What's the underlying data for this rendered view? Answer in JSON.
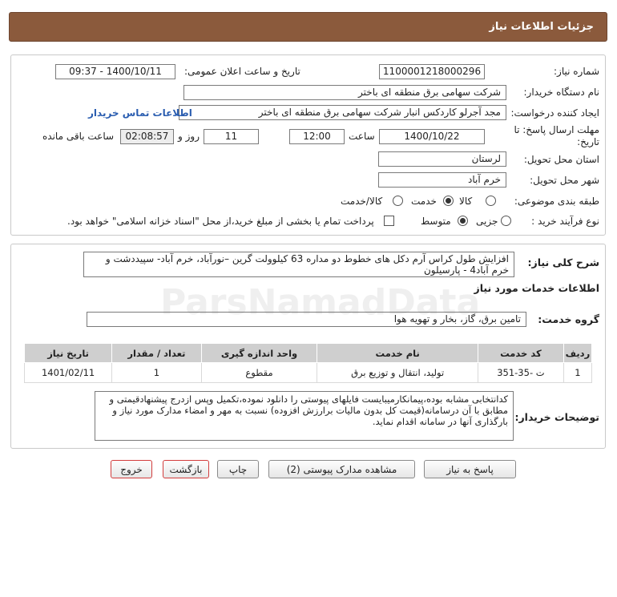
{
  "header": {
    "title": "جزئیات اطلاعات نیاز"
  },
  "form": {
    "need_number_label": "شماره نیاز:",
    "need_number": "1100001218000296",
    "announce_label": "تاریخ و ساعت اعلان عمومی:",
    "announce_value": "1400/10/11 - 09:37",
    "buyer_org_label": "نام دستگاه خریدار:",
    "buyer_org": "شرکت سهامی برق منطقه ای باختر",
    "requester_label": "ایجاد کننده درخواست:",
    "requester": "مجد آجرلو کاردکس انبار شرکت سهامی برق منطقه ای باختر",
    "contact_link": "اطلاعات تماس خریدار",
    "deadline_label": "مهلت ارسال پاسخ: تا تاریخ:",
    "deadline_date": "1400/10/22",
    "time_label": "ساعت",
    "deadline_time": "12:00",
    "days_value": "11",
    "days_label": "روز و",
    "remaining_time": "02:08:57",
    "remaining_label": "ساعت باقی مانده",
    "province_label": "استان محل تحویل:",
    "province": "لرستان",
    "city_label": "شهر محل تحویل:",
    "city": "خرم آباد",
    "category_label": "طبقه بندی موضوعی:",
    "category_options": [
      "کالا",
      "خدمت",
      "کالا/خدمت"
    ],
    "process_label": "نوع فرآیند خرید :",
    "process_options": [
      "جزیی",
      "متوسط"
    ],
    "payment_note": "پرداخت تمام یا بخشی از مبلغ خرید،از محل \"اسناد خزانه اسلامی\" خواهد بود."
  },
  "summary": {
    "label": "شرح کلی نیاز:",
    "text": "افزایش طول کراس آرم دکل های خطوط دو مداره 63 کیلوولت گرین –نورآباد، خرم آباد- سپیددشت و خرم آباد4 - پارسیلون"
  },
  "services": {
    "section_title": "اطلاعات خدمات مورد نیاز",
    "group_label": "گروه خدمت:",
    "group_value": "تامین برق، گاز، بخار و تهویه هوا"
  },
  "table": {
    "headers": [
      "ردیف",
      "کد خدمت",
      "نام خدمت",
      "واحد اندازه گیری",
      "تعداد / مقدار",
      "تاریخ نیاز"
    ],
    "rows": [
      [
        "1",
        "ت -35-351",
        "تولید، انتقال و توزیع برق",
        "مقطوع",
        "1",
        "1401/02/11"
      ]
    ]
  },
  "notes": {
    "label": "توضیحات خریدار:",
    "text": "کدانتخابی مشابه بوده،پیمانکارمیبایست فایلهای پیوستی را دانلود نموده،تکمیل وپس ازدرج پیشنهادقیمتی و مطابق با آن درسامانه(قیمت کل بدون مالیات برارزش افزوده) نسبت به مهر و امضاء مدارک مورد نیاز و بارگذاری آنها در سامانه اقدام نماید."
  },
  "buttons": {
    "reply": "پاسخ به نیاز",
    "attachments": "مشاهده مدارک پیوستی (2)",
    "print": "چاپ",
    "back": "بازگشت",
    "exit": "خروج"
  },
  "watermark": {
    "brand": "ParsNamadData"
  }
}
